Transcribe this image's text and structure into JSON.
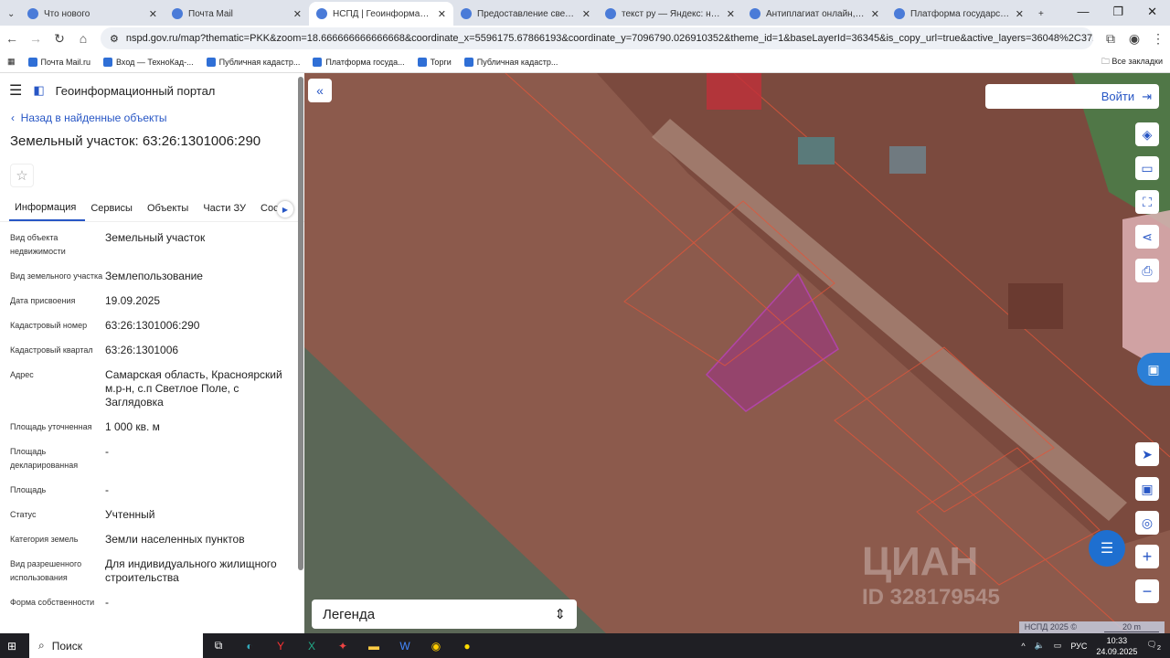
{
  "browser": {
    "tabs": [
      {
        "title": "Что нового",
        "active": false
      },
      {
        "title": "Почта Mail",
        "active": false
      },
      {
        "title": "НСПД | Геоинформационный",
        "active": true
      },
      {
        "title": "Предоставление сведений из",
        "active": false
      },
      {
        "title": "текст ру — Яндекс: нашлось 2",
        "active": false
      },
      {
        "title": "Антиплагиат онлайн, провер",
        "active": false
      },
      {
        "title": "Платформа государственных",
        "active": false
      }
    ],
    "url": "nspd.gov.ru/map?thematic=PKK&zoom=18.666666666666668&coordinate_x=5596175.67866193&coordinate_y=7096790.026910352&theme_id=1&baseLayerId=36345&is_copy_url=true&active_layers=36048%2C37294%2C36315%2C36328%2C36...",
    "bookmarks": [
      "Почта Mail.ru",
      "Вход — ТехноКад-...",
      "Публичная кадастр...",
      "Платформа госуда...",
      "Торги",
      "Публичная кадастр..."
    ],
    "all_bookmarks": "Все закладки"
  },
  "portal": {
    "title": "Геоинформационный портал",
    "back": "Назад в найденные объекты",
    "object_title": "Земельный участок: 63:26:1301006:290",
    "tabs": [
      "Информация",
      "Сервисы",
      "Объекты",
      "Части ЗУ",
      "Соста"
    ],
    "fields": [
      {
        "k": "Вид объекта недвижимости",
        "v": "Земельный участок"
      },
      {
        "k": "Вид земельного участка",
        "v": "Землепользование"
      },
      {
        "k": "Дата присвоения",
        "v": "19.09.2025"
      },
      {
        "k": "Кадастровый номер",
        "v": "63:26:1301006:290"
      },
      {
        "k": "Кадастровый квартал",
        "v": "63:26:1301006"
      },
      {
        "k": "Адрес",
        "v": "Самарская область, Красноярский м.р-н, с.п Светлое Поле, с Заглядовка"
      },
      {
        "k": "Площадь уточненная",
        "v": "1 000 кв. м"
      },
      {
        "k": "Площадь декларированная",
        "v": "-"
      },
      {
        "k": "Площадь",
        "v": "-"
      },
      {
        "k": "Статус",
        "v": "Учтенный"
      },
      {
        "k": "Категория земель",
        "v": "Земли населенных пунктов"
      },
      {
        "k": "Вид разрешенного использования",
        "v": "Для индивидуального жилищного строительства"
      },
      {
        "k": "Форма собственности",
        "v": "-"
      }
    ]
  },
  "map": {
    "login": "Войти",
    "legend": "Легенда",
    "attribution": "НСПД 2025 ©",
    "scale": "20 m",
    "watermark": "ЦИАН",
    "watermark_id": "ID 328179545"
  },
  "taskbar": {
    "search": "Поиск",
    "lang": "РУС",
    "time": "10:33",
    "date": "24.09.2025",
    "notifications": "2"
  }
}
